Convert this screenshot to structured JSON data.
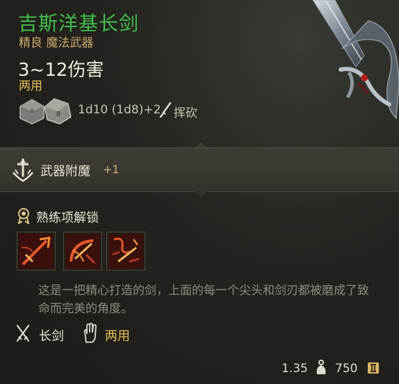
{
  "item": {
    "name": "吉斯洋基长剑",
    "subtitle": "精良 魔法武器",
    "damage": "3~12伤害",
    "handedness": "两用",
    "dice_formula": "1d10 (1d8)+2",
    "damage_type": "挥砍",
    "name_color": "#3fbf4a"
  },
  "enchantment": {
    "label": "武器附魔",
    "value": "+1"
  },
  "proficiency": {
    "label": "熟练项解锁",
    "skills": [
      {
        "icon": "lunge-strike-icon"
      },
      {
        "icon": "sweeping-slash-icon"
      },
      {
        "icon": "flourish-icon"
      }
    ]
  },
  "description": "这是一把精心打造的剑，上面的每一个尖头和剑刃都被磨成了致命而完美的角度。",
  "tags": {
    "weapon_type": "长剑",
    "grip": "两用"
  },
  "footer": {
    "weight": "1.35",
    "value": "750"
  }
}
